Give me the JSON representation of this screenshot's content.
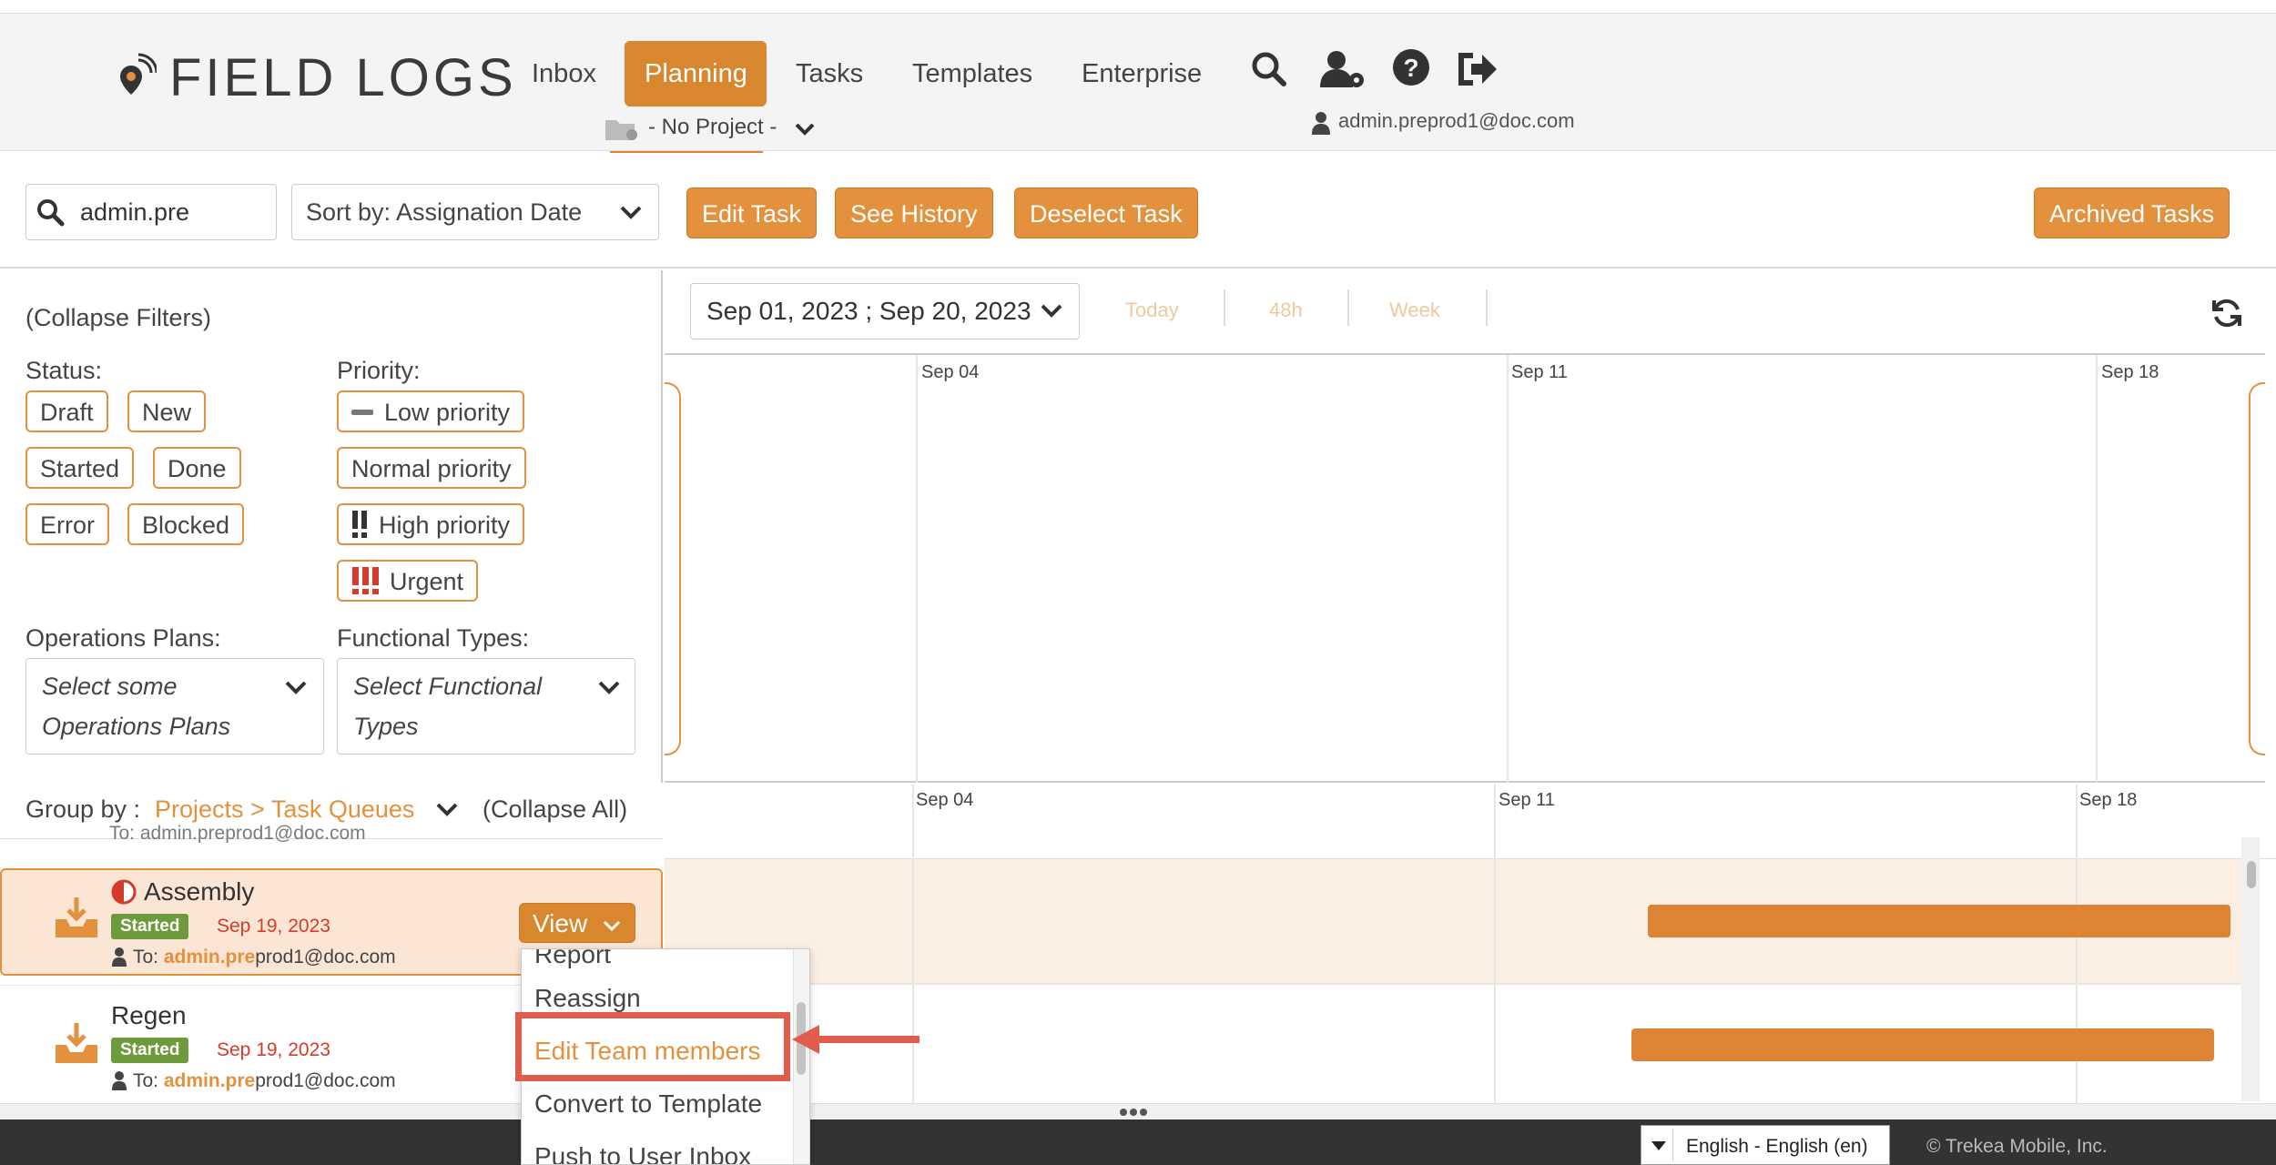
{
  "brand": {
    "name": "FIELD LOGS"
  },
  "nav": {
    "items": [
      {
        "label": "Inbox"
      },
      {
        "label": "Planning"
      },
      {
        "label": "Tasks"
      },
      {
        "label": "Templates"
      },
      {
        "label": "Enterprise"
      }
    ],
    "active": "Planning"
  },
  "header": {
    "project_selector": "- No Project -",
    "user_email": "admin.preprod1@doc.com"
  },
  "toolbar": {
    "search_value": "admin.pre",
    "sort_label": "Sort by: Assignation Date",
    "edit_task": "Edit Task",
    "see_history": "See History",
    "deselect_task": "Deselect Task",
    "archived_tasks": "Archived Tasks"
  },
  "filters": {
    "collapse": "(Collapse Filters)",
    "status_label": "Status:",
    "statuses": [
      "Draft",
      "New",
      "Started",
      "Done",
      "Error",
      "Blocked"
    ],
    "priority_label": "Priority:",
    "priorities": [
      "Low priority",
      "Normal priority",
      "High priority",
      "Urgent"
    ],
    "ops_label": "Operations Plans:",
    "ops_placeholder_1": "Select some",
    "ops_placeholder_2": "Operations Plans",
    "func_label": "Functional Types:",
    "func_placeholder_1": "Select Functional",
    "func_placeholder_2": "Types"
  },
  "timeline": {
    "range": "Sep 01, 2023 ; Sep 20, 2023",
    "quick": [
      "Today",
      "48h",
      "Week"
    ],
    "dates": [
      "Sep 04",
      "Sep 11",
      "Sep 18"
    ]
  },
  "group": {
    "label": "Group by :",
    "value": "Projects > Task Queues",
    "collapse_all": "(Collapse All)",
    "partial_to": "To: admin.preprod1@doc.com"
  },
  "tasks": [
    {
      "name": "Assembly",
      "status": "Started",
      "date": "Sep 19, 2023",
      "to_prefix": "To: ",
      "to_bold": "admin.pre",
      "to_rest": "prod1@doc.com",
      "action": "View"
    },
    {
      "name": "Regen",
      "status": "Started",
      "date": "Sep 19, 2023",
      "to_prefix": "To: ",
      "to_bold": "admin.pre",
      "to_rest": "prod1@doc.com"
    }
  ],
  "dropdown": {
    "items": [
      "Report",
      "Reassign",
      "Edit Team members",
      "Convert to Template",
      "Push to User Inbox"
    ],
    "highlighted": "Edit Team members"
  },
  "footer": {
    "language": "English - English (en)",
    "copyright": "© Trekea Mobile, Inc."
  },
  "colors": {
    "accent": "#e3913c",
    "accent_dark": "#d8872f",
    "started": "#6d9a3a",
    "date_red": "#d63a2a",
    "callout": "#e25c4c",
    "bar": "#dd8333"
  }
}
